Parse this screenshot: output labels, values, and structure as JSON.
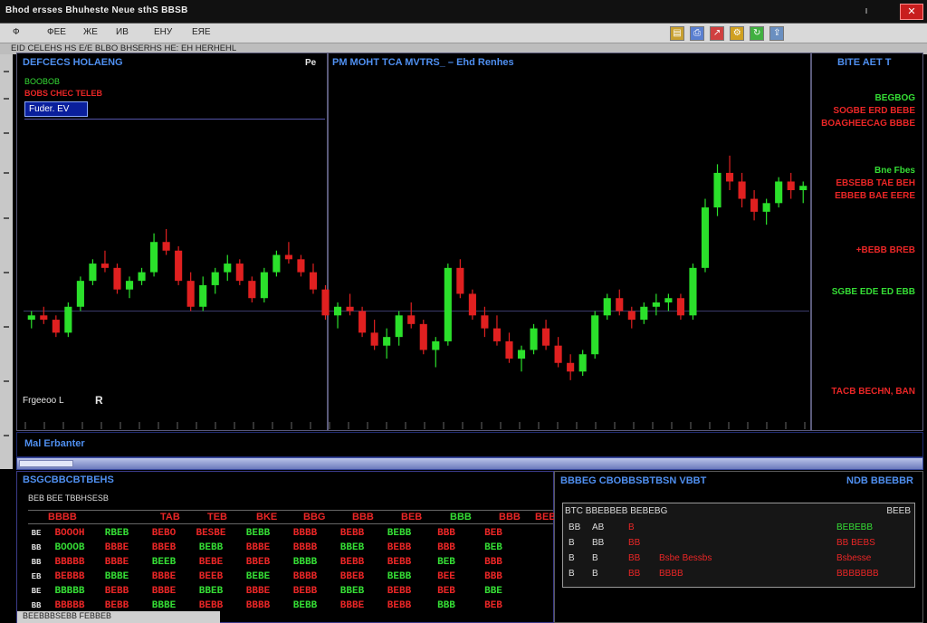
{
  "window": {
    "title": "Bhod ersses Bhuheste Neue sthS BBSB",
    "close_label": "✕"
  },
  "menubar": {
    "items": [
      "Ф",
      "ФЕЕ",
      "ЖЕ",
      "ИВ",
      "ЕНУ",
      "ЕЯЕ"
    ],
    "icons": [
      "folder-icon",
      "print-icon",
      "chart-icon",
      "settings-icon",
      "refresh-icon",
      "export-icon"
    ]
  },
  "navbar": {
    "text": "EID CELEHS HS E/E BLBO BHSERHS HE: EH HERHEHL"
  },
  "panels": {
    "left": {
      "title": "DEFCECS HOLAENG",
      "tag_green": "BOOBOB",
      "tag_red": "BOBS CHEC TELEB",
      "selected": "Fuder. EV",
      "bottom_label": "Frgeeoo L",
      "bottom_marker": "R"
    },
    "mid": {
      "marker": "Pe",
      "title": "PM MOHT TCA MVTRS_ – Ehd Renhes"
    },
    "right": {
      "title": "BITE AET T",
      "quotes": [
        {
          "label": "BEGBOG",
          "color": "green"
        },
        {
          "label": "SOGBE ERD BEBE",
          "color": "red"
        },
        {
          "label": "BOAGHEECAG BBBE",
          "color": "red"
        },
        {
          "label": "Bne Fbes",
          "color": "green"
        },
        {
          "label": "EBSEBB TAE BEH",
          "color": "red"
        },
        {
          "label": "EBBEB BAE EERE",
          "color": "red"
        },
        {
          "label": "+BEBB BREB",
          "color": "red"
        },
        {
          "label": "SGBE EDE ED EBB",
          "color": "green"
        },
        {
          "label": "TACB BECHN, BAN",
          "color": "red"
        }
      ]
    }
  },
  "strip": {
    "label": "Mal Erbanter"
  },
  "ticker": {
    "title": "BSGCBBCBTBEHS",
    "subtitle": "BEB    BEE TBBHSESB",
    "headers": [
      "BBBB",
      "TAB",
      "TEB",
      "BKE",
      "BBG",
      "BBB",
      "BEB",
      "BBB",
      "BBB",
      "BEB"
    ],
    "rows": [
      {
        "label": "BE",
        "cells": [
          "BOOOH",
          "RBEB",
          "BEBO",
          "BESBE",
          "BEBB",
          "BBBB",
          "BEBB",
          "BEBB",
          "BBB",
          "BEB"
        ]
      },
      {
        "label": "BB",
        "cells": [
          "BOOOB",
          "BBBE",
          "BBEB",
          "BEBB",
          "BBBE",
          "BBBB",
          "BBEB",
          "BEBB",
          "BBB",
          "BEB"
        ]
      },
      {
        "label": "BB",
        "cells": [
          "BBBBB",
          "BBBE",
          "BEEB",
          "BEBE",
          "BBEB",
          "BBBB",
          "BEBB",
          "BEBB",
          "BEB",
          "BBB"
        ]
      },
      {
        "label": "EB",
        "cells": [
          "BEBBB",
          "BBBE",
          "BBBE",
          "BEEB",
          "BEBE",
          "BBBB",
          "BBEB",
          "BEBB",
          "BEE",
          "BBB"
        ]
      },
      {
        "label": "BE",
        "cells": [
          "BBBBB",
          "BEBB",
          "BBBE",
          "BBEB",
          "BBBE",
          "BEBB",
          "BBEB",
          "BEBB",
          "BEB",
          "BBE"
        ]
      },
      {
        "label": "BB",
        "cells": [
          "BBBBB",
          "BEBB",
          "BBBE",
          "BEBB",
          "BBBB",
          "BEBB",
          "BBBE",
          "BEBB",
          "BBB",
          "BEB"
        ]
      }
    ],
    "footer": "BEEBBBSEBB     FEBBEB"
  },
  "orderbox": {
    "title": "BBBEG CBOBBSBTBSN VBBT",
    "title_right": "NDB BBEBBR",
    "header_left": "BTC BBEBBEB BEBEBG",
    "header_right": "BEEB",
    "rows": [
      {
        "a": "BB",
        "b": "AB",
        "c": "B",
        "d": "",
        "e": "BEBEBB"
      },
      {
        "a": "B",
        "b": "BB",
        "c": "BB",
        "d": "",
        "e": "BB BEBS"
      },
      {
        "a": "B",
        "b": "B",
        "c": "BB",
        "d": "Bsbe Bessbs",
        "e": "Bsbesse"
      },
      {
        "a": "B",
        "b": "B",
        "c": "BB",
        "d": "BBBB",
        "e": "BBBBBBB"
      }
    ]
  },
  "chart_data": {
    "type": "line",
    "series": [
      {
        "kind": "candlestick",
        "values": [
          [
            42,
            44,
            40,
            43
          ],
          [
            43,
            45,
            41,
            42
          ],
          [
            42,
            43,
            38,
            39
          ],
          [
            39,
            46,
            38,
            45
          ],
          [
            45,
            52,
            44,
            51
          ],
          [
            51,
            56,
            50,
            55
          ],
          [
            55,
            58,
            53,
            54
          ],
          [
            54,
            55,
            48,
            49
          ],
          [
            49,
            52,
            47,
            51
          ],
          [
            51,
            54,
            50,
            53
          ],
          [
            53,
            62,
            52,
            60
          ],
          [
            60,
            63,
            57,
            58
          ],
          [
            58,
            59,
            50,
            51
          ],
          [
            51,
            53,
            44,
            45
          ],
          [
            45,
            52,
            44,
            50
          ],
          [
            50,
            54,
            48,
            53
          ],
          [
            53,
            57,
            51,
            55
          ],
          [
            55,
            56,
            50,
            51
          ],
          [
            51,
            52,
            46,
            47
          ],
          [
            47,
            54,
            46,
            53
          ],
          [
            53,
            58,
            52,
            57
          ],
          [
            57,
            60,
            55,
            56
          ],
          [
            56,
            57,
            52,
            53
          ],
          [
            53,
            55,
            48,
            49
          ],
          [
            49,
            50,
            42,
            43
          ],
          [
            43,
            46,
            40,
            45
          ],
          [
            45,
            48,
            43,
            44
          ],
          [
            44,
            45,
            38,
            39
          ],
          [
            39,
            42,
            35,
            36
          ],
          [
            36,
            40,
            33,
            38
          ],
          [
            38,
            44,
            36,
            43
          ],
          [
            43,
            46,
            40,
            41
          ],
          [
            41,
            42,
            34,
            35
          ],
          [
            35,
            38,
            31,
            37
          ],
          [
            37,
            55,
            36,
            54
          ],
          [
            54,
            56,
            47,
            48
          ],
          [
            48,
            49,
            42,
            43
          ],
          [
            43,
            45,
            38,
            40
          ],
          [
            40,
            43,
            36,
            37
          ],
          [
            37,
            39,
            32,
            33
          ],
          [
            33,
            36,
            30,
            35
          ],
          [
            35,
            41,
            34,
            40
          ],
          [
            40,
            42,
            35,
            36
          ],
          [
            36,
            38,
            31,
            32
          ],
          [
            32,
            34,
            28,
            30
          ],
          [
            30,
            35,
            29,
            34
          ],
          [
            34,
            44,
            33,
            43
          ],
          [
            43,
            48,
            42,
            47
          ],
          [
            47,
            49,
            43,
            44
          ],
          [
            44,
            45,
            40,
            42
          ],
          [
            42,
            46,
            41,
            45
          ],
          [
            45,
            48,
            43,
            46
          ],
          [
            46,
            48,
            44,
            47
          ],
          [
            47,
            48,
            42,
            43
          ],
          [
            43,
            55,
            42,
            54
          ],
          [
            54,
            70,
            53,
            68
          ],
          [
            68,
            78,
            66,
            76
          ],
          [
            76,
            80,
            72,
            74
          ],
          [
            74,
            76,
            68,
            70
          ],
          [
            70,
            72,
            65,
            67
          ],
          [
            67,
            70,
            64,
            69
          ],
          [
            69,
            75,
            68,
            74
          ],
          [
            74,
            76,
            70,
            72
          ],
          [
            72,
            74,
            69,
            73
          ]
        ]
      }
    ],
    "ylim": [
      20,
      85
    ],
    "reference_lines": [
      44,
      44
    ],
    "colors": {
      "up": "#2be02b",
      "down": "#e02020",
      "grid": "#3a3a6a"
    }
  }
}
